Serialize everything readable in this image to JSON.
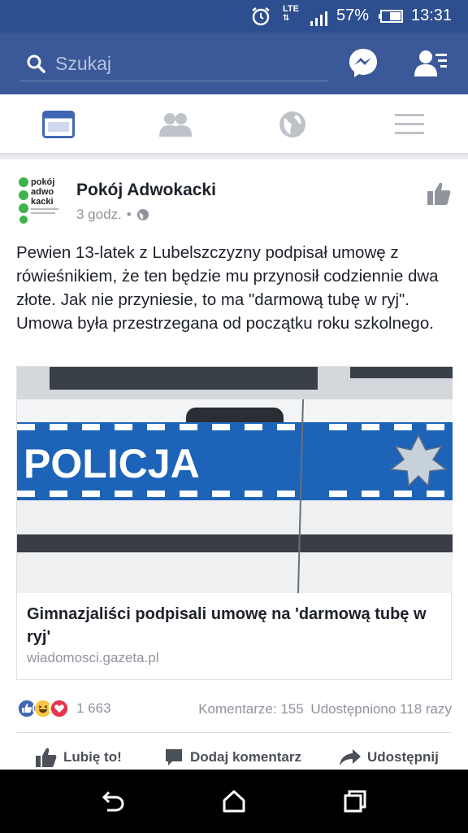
{
  "status_bar": {
    "network": "LTE",
    "battery": "57%",
    "time": "13:31"
  },
  "search": {
    "placeholder": "Szukaj"
  },
  "post": {
    "page_name": "Pokój Adwokacki",
    "time": "3 godz.",
    "separator": "•",
    "avatar_text": [
      "pokój",
      "adwo",
      "kacki"
    ],
    "text": "Pewien 13-latek z Lubelszczyzny podpisał umowę z rówieśnikiem, że ten będzie mu przynosił codziennie dwa złote. Jak nie przyniesie, to ma \"darmową tubę w ryj\". Umowa była przestrzegana od początku roku szkolnego.",
    "link": {
      "image_text": "POLICJA",
      "title": "Gimnazjaliści podpisali umowę na 'darmową tubę w ryj'",
      "domain": "wiadomosci.gazeta.pl"
    },
    "reaction_count": "1 663",
    "comments": "Komentarze: 155",
    "shares": "Udostępniono 118 razy",
    "actions": {
      "like": "Lubię to!",
      "comment": "Dodaj komentarz",
      "share": "Udostępnij"
    }
  },
  "colors": {
    "brand": "#3b5998",
    "status_bar": "#2d4f8f",
    "police_blue": "#1d63b8"
  },
  "icons": [
    "alarm-icon",
    "signal-icon",
    "battery-icon",
    "search-icon",
    "messenger-icon",
    "friend-requests-icon",
    "news-feed-icon",
    "friends-icon",
    "globe-icon",
    "menu-icon",
    "like-icon",
    "comment-icon",
    "share-icon",
    "back-icon",
    "home-icon",
    "recents-icon"
  ]
}
